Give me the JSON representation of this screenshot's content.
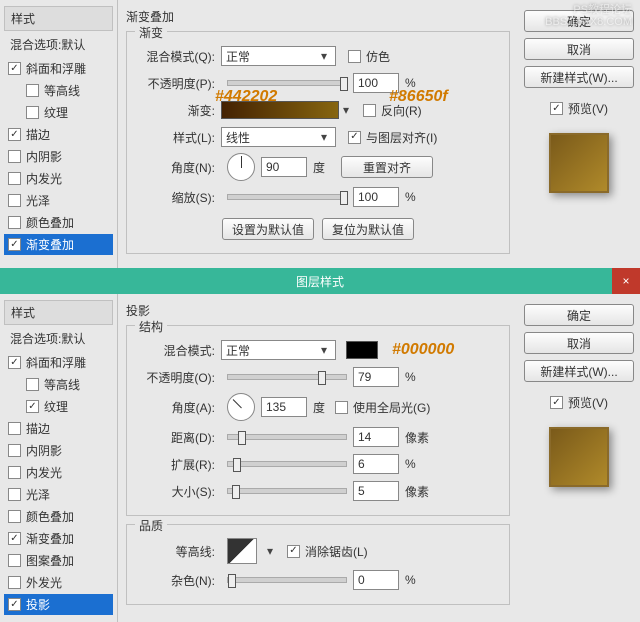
{
  "top": {
    "watermark1": "PS教程论坛",
    "watermark2": "BBS.16XX8.COM",
    "sidebar": {
      "head": "样式",
      "sub": "混合选项:默认",
      "items": [
        {
          "label": "斜面和浮雕",
          "checked": true,
          "indent": false
        },
        {
          "label": "等高线",
          "checked": false,
          "indent": true
        },
        {
          "label": "纹理",
          "checked": false,
          "indent": true
        },
        {
          "label": "描边",
          "checked": true,
          "indent": false
        },
        {
          "label": "内阴影",
          "checked": false,
          "indent": false
        },
        {
          "label": "内发光",
          "checked": false,
          "indent": false
        },
        {
          "label": "光泽",
          "checked": false,
          "indent": false
        },
        {
          "label": "颜色叠加",
          "checked": false,
          "indent": false
        },
        {
          "label": "渐变叠加",
          "checked": true,
          "indent": false,
          "selected": true
        }
      ]
    },
    "section": "渐变叠加",
    "group": "渐变",
    "labels": {
      "blend": "混合模式(Q):",
      "opacity": "不透明度(P):",
      "gradient": "渐变:",
      "style": "样式(L):",
      "angle": "角度(N):",
      "scale": "缩放(S):"
    },
    "values": {
      "blend": "正常",
      "opacity": "100",
      "style": "线性",
      "angle": "90",
      "scale": "100"
    },
    "checks": {
      "dither": "仿色",
      "reverse": "反向(R)",
      "align": "与图层对齐(I)"
    },
    "units": {
      "pct": "%",
      "deg": "度"
    },
    "buttons": {
      "reset_align": "重置对齐",
      "set_default": "设置为默认值",
      "reset_default": "复位为默认值"
    },
    "annot": {
      "c1": "#442202",
      "c2": "#86650f"
    },
    "right": {
      "ok": "确定",
      "cancel": "取消",
      "new": "新建样式(W)...",
      "preview": "预览(V)"
    }
  },
  "titlebar": "图层样式",
  "close": "×",
  "bottom": {
    "sidebar": {
      "head": "样式",
      "sub": "混合选项:默认",
      "items": [
        {
          "label": "斜面和浮雕",
          "checked": true,
          "indent": false
        },
        {
          "label": "等高线",
          "checked": false,
          "indent": true
        },
        {
          "label": "纹理",
          "checked": true,
          "indent": true
        },
        {
          "label": "描边",
          "checked": false,
          "indent": false
        },
        {
          "label": "内阴影",
          "checked": false,
          "indent": false
        },
        {
          "label": "内发光",
          "checked": false,
          "indent": false
        },
        {
          "label": "光泽",
          "checked": false,
          "indent": false
        },
        {
          "label": "颜色叠加",
          "checked": false,
          "indent": false
        },
        {
          "label": "渐变叠加",
          "checked": true,
          "indent": false
        },
        {
          "label": "图案叠加",
          "checked": false,
          "indent": false
        },
        {
          "label": "外发光",
          "checked": false,
          "indent": false
        },
        {
          "label": "投影",
          "checked": true,
          "indent": false,
          "selected": true
        }
      ]
    },
    "section": "投影",
    "group1": "结构",
    "group2": "品质",
    "labels": {
      "blend": "混合模式:",
      "opacity": "不透明度(O):",
      "angle": "角度(A):",
      "distance": "距离(D):",
      "spread": "扩展(R):",
      "size": "大小(S):",
      "contour": "等高线:",
      "noise": "杂色(N):"
    },
    "values": {
      "blend": "正常",
      "opacity": "79",
      "angle": "135",
      "distance": "14",
      "spread": "6",
      "size": "5",
      "noise": "0"
    },
    "checks": {
      "global": "使用全局光(G)",
      "anti": "消除锯齿(L)"
    },
    "units": {
      "pct": "%",
      "deg": "度",
      "px": "像素"
    },
    "annot": {
      "c1": "#000000"
    },
    "right": {
      "ok": "确定",
      "cancel": "取消",
      "new": "新建样式(W)...",
      "preview": "预览(V)"
    }
  }
}
